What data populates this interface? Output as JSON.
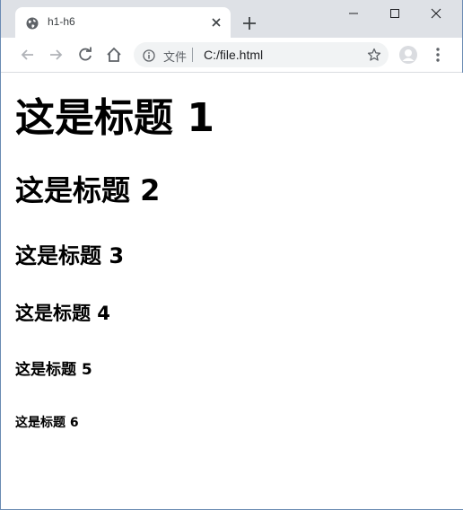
{
  "tab": {
    "title": "h1-h6",
    "favicon": "globe-icon"
  },
  "window_controls": {
    "minimize": "minimize-icon",
    "maximize": "maximize-icon",
    "close": "close-icon"
  },
  "toolbar": {
    "back": "back-arrow-icon",
    "forward": "forward-arrow-icon",
    "reload": "reload-icon",
    "home": "home-icon"
  },
  "omnibox": {
    "security_label": "文件",
    "url": "C:/file.html"
  },
  "page": {
    "headings": {
      "h1": "这是标题 1",
      "h2": "这是标题 2",
      "h3": "这是标题 3",
      "h4": "这是标题 4",
      "h5": "这是标题 5",
      "h6": "这是标题 6"
    }
  },
  "colors": {
    "titlebar": "#dee1e6",
    "omnibox": "#f1f3f4",
    "window_border": "#6b8bb3"
  }
}
